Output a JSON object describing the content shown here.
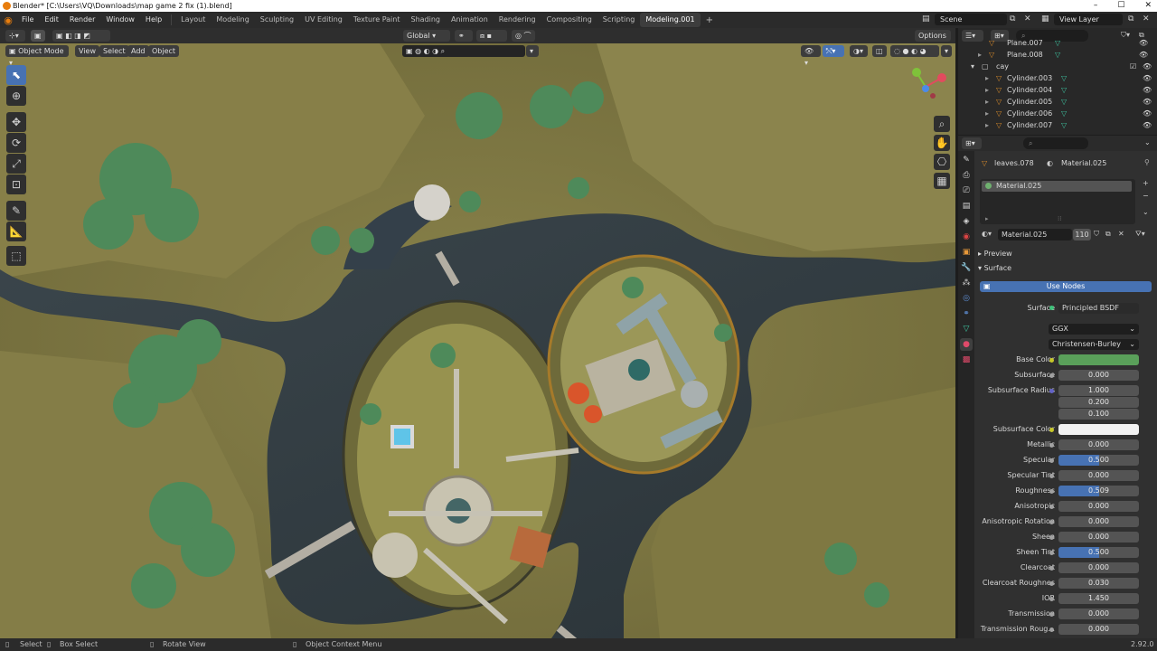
{
  "window": {
    "title": "Blender* [C:\\Users\\VQ\\Downloads\\map game 2 fix (1).blend]"
  },
  "menu": [
    "File",
    "Edit",
    "Render",
    "Window",
    "Help"
  ],
  "workspaces": [
    "Layout",
    "Modeling",
    "Sculpting",
    "UV Editing",
    "Texture Paint",
    "Shading",
    "Animation",
    "Rendering",
    "Compositing",
    "Scripting",
    "Modeling.001"
  ],
  "active_workspace": "Modeling.001",
  "scene": {
    "name": "Scene",
    "view_layer": "View Layer"
  },
  "viewport_header": {
    "mode": "Object Mode",
    "menus": [
      "View",
      "Select",
      "Add",
      "Object"
    ],
    "transform_orientation": "Global",
    "options": "Options"
  },
  "outliner": {
    "rows": [
      {
        "name": "Plane.007",
        "indent": 2
      },
      {
        "name": "Plane.008",
        "indent": 2
      },
      {
        "name": "cay",
        "indent": 1
      },
      {
        "name": "Cylinder.003",
        "indent": 2
      },
      {
        "name": "Cylinder.004",
        "indent": 2
      },
      {
        "name": "Cylinder.005",
        "indent": 2
      },
      {
        "name": "Cylinder.006",
        "indent": 2
      },
      {
        "name": "Cylinder.007",
        "indent": 2
      }
    ]
  },
  "properties": {
    "object": "leaves.078",
    "material": "Material.025",
    "slot": "Material.025",
    "datablock": "Material.025",
    "users": "110",
    "sections": {
      "preview": "Preview",
      "surface": "Surface"
    },
    "use_nodes": "Use Nodes",
    "surface_label": "Surface",
    "surface_shader": "Principled BSDF",
    "distribution": "GGX",
    "subsurface_method": "Christensen-Burley",
    "params": [
      {
        "label": "Base Color",
        "type": "color",
        "color": "#5aa05a",
        "socket": "yellow"
      },
      {
        "label": "Subsurface",
        "value": "0.000",
        "fill": 0,
        "socket": "grey"
      },
      {
        "label": "Subsurface Radius",
        "vector": [
          "1.000",
          "0.200",
          "0.100"
        ],
        "socket": "blue"
      },
      {
        "label": "Subsurface Color",
        "type": "color",
        "color": "#f2f2f2",
        "socket": "yellow"
      },
      {
        "label": "Metallic",
        "value": "0.000",
        "fill": 0,
        "socket": "grey"
      },
      {
        "label": "Specular",
        "value": "0.500",
        "fill": 0.5,
        "socket": "grey"
      },
      {
        "label": "Specular Tint",
        "value": "0.000",
        "fill": 0,
        "socket": "grey"
      },
      {
        "label": "Roughness",
        "value": "0.509",
        "fill": 0.509,
        "socket": "grey"
      },
      {
        "label": "Anisotropic",
        "value": "0.000",
        "fill": 0,
        "socket": "grey"
      },
      {
        "label": "Anisotropic Rotation",
        "value": "0.000",
        "fill": 0,
        "socket": "grey"
      },
      {
        "label": "Sheen",
        "value": "0.000",
        "fill": 0,
        "socket": "grey"
      },
      {
        "label": "Sheen Tint",
        "value": "0.500",
        "fill": 0.5,
        "socket": "grey"
      },
      {
        "label": "Clearcoat",
        "value": "0.000",
        "fill": 0,
        "socket": "grey"
      },
      {
        "label": "Clearcoat Roughnes",
        "value": "0.030",
        "fill": 0.03,
        "socket": "grey"
      },
      {
        "label": "IOR",
        "value": "1.450",
        "fill": 0,
        "socket": "grey"
      },
      {
        "label": "Transmission",
        "value": "0.000",
        "fill": 0,
        "socket": "grey"
      },
      {
        "label": "Transmission Roug...",
        "value": "0.000",
        "fill": 0,
        "socket": "grey"
      }
    ]
  },
  "statusbar": {
    "select": "Select",
    "box_select": "Box Select",
    "rotate_view": "Rotate View",
    "context_menu": "Object Context Menu",
    "version": "2.92.0"
  },
  "colors": {
    "accent": "#4772b3",
    "grass": "#7f7a44",
    "water": "#2f3a40"
  }
}
